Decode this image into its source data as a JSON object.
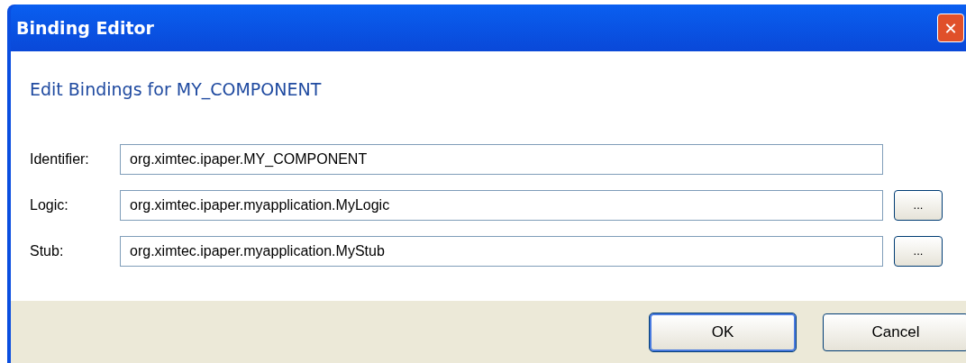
{
  "window": {
    "title": "Binding Editor",
    "close": "✕"
  },
  "heading": "Edit Bindings for MY_COMPONENT",
  "fields": [
    {
      "label": "Identifier:",
      "value": "org.ximtec.ipaper.MY_COMPONENT",
      "browse": false
    },
    {
      "label": "Logic:",
      "value": "org.ximtec.ipaper.myapplication.MyLogic",
      "browse": true,
      "browse_label": "..."
    },
    {
      "label": "Stub:",
      "value": "org.ximtec.ipaper.myapplication.MyStub",
      "browse": true,
      "browse_label": "..."
    }
  ],
  "buttons": [
    {
      "label": "OK",
      "default": true
    },
    {
      "label": "Cancel",
      "default": false
    }
  ]
}
